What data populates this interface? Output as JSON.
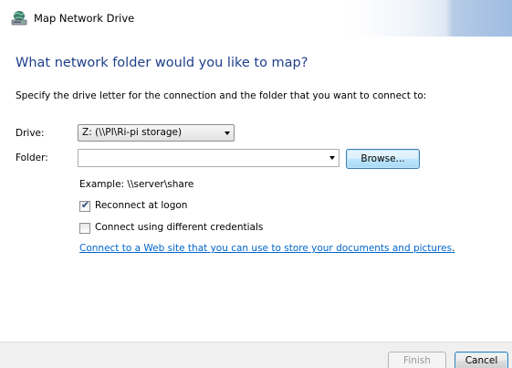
{
  "window": {
    "title": "Map Network Drive"
  },
  "heading": "What network folder would you like to map?",
  "instruction": "Specify the drive letter for the connection and the folder that you want to connect to:",
  "drive": {
    "label": "Drive:",
    "selected": "Z: (\\\\PI\\Ri-pi storage)"
  },
  "folder": {
    "label": "Folder:",
    "value": "",
    "browse_label": "Browse...",
    "example": "Example: \\\\server\\share"
  },
  "options": {
    "reconnect_label": "Reconnect at logon",
    "reconnect_checked": true,
    "credentials_label": "Connect using different credentials",
    "credentials_checked": false
  },
  "link_text": "Connect to a Web site that you can use to store your documents and pictures",
  "link_suffix": ".",
  "footer": {
    "finish_label": "Finish",
    "cancel_label": "Cancel"
  },
  "colors": {
    "heading": "#1e3f8a",
    "link": "#0066cc"
  },
  "icons": {
    "title": "network-drive-icon",
    "dropdown": "chevron-down-icon",
    "check": "checkmark-icon"
  }
}
